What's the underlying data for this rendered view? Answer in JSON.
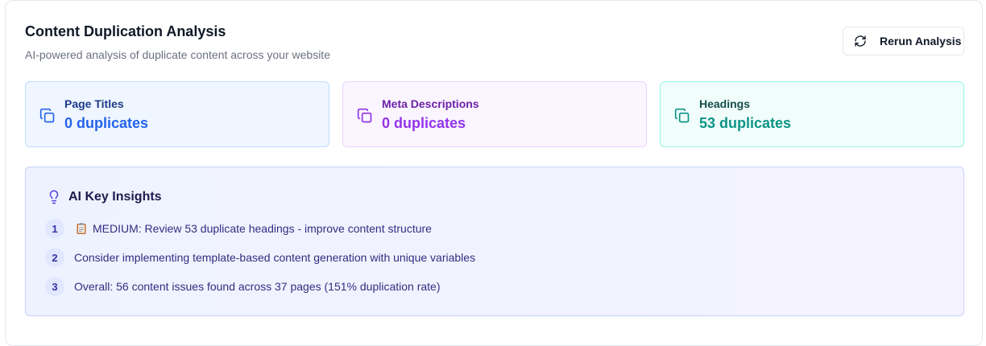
{
  "header": {
    "title": "Content Duplication Analysis",
    "subtitle": "AI-powered analysis of duplicate content across your website",
    "rerun_label": "Rerun Analysis"
  },
  "cards": [
    {
      "name": "Page Titles",
      "count": "0 duplicates",
      "accent": "#2563eb",
      "icon": "copy-icon"
    },
    {
      "name": "Meta Descriptions",
      "count": "0 duplicates",
      "accent": "#9333ea",
      "icon": "copy-icon"
    },
    {
      "name": "Headings",
      "count": "53 duplicates",
      "accent": "#0d9488",
      "icon": "copy-icon"
    }
  ],
  "insights": {
    "heading": "AI Key Insights",
    "icon": "lightbulb-icon",
    "items": [
      {
        "num": "1",
        "text": "MEDIUM: Review 53 duplicate headings - improve content structure",
        "icon": "clipboard-icon"
      },
      {
        "num": "2",
        "text": "Consider implementing template-based content generation with unique variables"
      },
      {
        "num": "3",
        "text": "Overall: 56 content issues found across 37 pages (151% duplication rate)"
      }
    ]
  }
}
